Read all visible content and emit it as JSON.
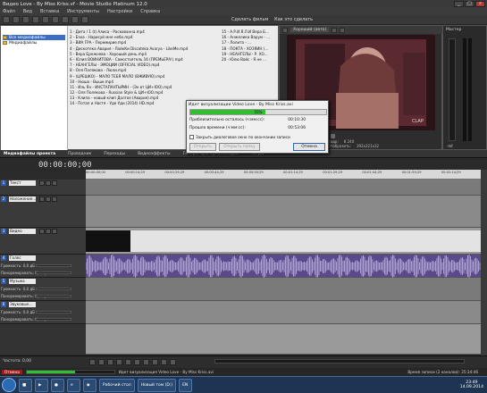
{
  "window": {
    "title": "Видео Love - By Miss Kriss.vf - Movie Studio Platinum 12.0",
    "controls": [
      "_",
      "□",
      "x"
    ]
  },
  "menu": [
    "Файл",
    "Вид",
    "Вставка",
    "Инструменты",
    "Настройки",
    "Справка"
  ],
  "toolbar": {
    "make_movie": "Сделать фильм",
    "as_this": "Как это сделать"
  },
  "media_tree": [
    "Все медиафайлы",
    "Медиафайлы"
  ],
  "media_files_col1": [
    "1 - Дита / 1 (t) Алиса - Раскованна.mp4",
    "2 - Бэха - Нарисуй мне небо.mp4",
    "3 - ВИА ГРА - Перемирие.mp4",
    "4 - Дискотека Авария - ЛайкКи Disсoteka Avarya - LikeMe.mp4",
    "5 - Вера Брежнева - Хороший день.mp4",
    "6 - Юлия ВОИНИТОВА - Самостоятель 16 (ПРЕМЬЕРА!).mp4",
    "7 - НЕАНГЕЛЫ - ЭМОЦИИ (OFFICIAL VIDEO).mp4",
    "8 - Оля Полякова - Люли.mp4",
    "9 - (ЦРЕШКО) - МАЛО ТЕБЯ МАЛО (ВЖИВУЮ).mp4",
    "10 - Нюша - Выше.mp4",
    "11 - Иль Ян - ИНСТАПАНТЫРИН - (Эн вт ЦИ+ЮО).mp4",
    "12 - Оля Полякова - Russian Style & ЦИ+ЮО.mp4",
    "13 - Клипа - новый клип Долгое (Авария).mp4",
    "14 - Потап и Настя - Уде Уди (2014) HD.mp4"
  ],
  "media_files_col2": [
    "15 - А.Р.И.Я.Л.И Вера Б...",
    "16 - Анжелика Варум - ...",
    "17 - Лолита - ...",
    "18 - ПОКТА - ХОЗЯИН (...",
    "19 - НЕАНГЕЛЫ - Р. ХО...",
    "20 - Юлю Войс - Я не ..."
  ],
  "preview": {
    "quality": "Хороший (авто)",
    "watermark": "CLAP",
    "info_project": "1280x720, 25.000i",
    "info_preview": "1280x720, 25.000i",
    "info_display": "1280x720, 25.000i",
    "frame_label": "Кадр:",
    "frame_value": "8 240",
    "display_label": "Отобразить:",
    "display_value": "392x221x32"
  },
  "master": {
    "label": "Мастер",
    "fader": "-Inf."
  },
  "tabs": [
    "Медиафайлы проекта",
    "Проводник",
    "Переходы",
    "Видеоэффекты",
    "Генераторы мультимедиа",
    "Титры"
  ],
  "timecode": "00:00:00;00",
  "ruler_ticks": [
    "00:00:00;00",
    "00:00:14;29",
    "00:00:29;29",
    "00:00:44;29",
    "00:00:59;29",
    "00:01:14;29",
    "00:01:29;29",
    "00:01:44;29",
    "00:01:59;29",
    "00:02:14;29"
  ],
  "tracks": [
    {
      "num": "1",
      "name": "Текст"
    },
    {
      "num": "2",
      "name": "Наложение..."
    },
    {
      "num": "3",
      "name": "Видео"
    },
    {
      "num": "4",
      "name": "Голос",
      "params": [
        "Громкость: 0,0 дБ",
        "Панорамировать: Центр"
      ]
    },
    {
      "num": "5",
      "name": "Музыка",
      "params": [
        "Громкость: 0,0 дБ",
        "Панорамировать: Центр"
      ]
    },
    {
      "num": "6",
      "name": "Звуковые...",
      "params": [
        "Громкость: 0,0 дБ",
        "Панорамировать: Центр"
      ]
    }
  ],
  "status": {
    "rate": "Частота: 0,00",
    "progress_label": "Отмена",
    "progress_text": "Идет визуализация Video Love - By Miss Kriss.avi",
    "record_time": "Время записи (2 каналов): 25:34:46"
  },
  "dialog": {
    "title": "Идет визуализации Video Love - By Miss Kriss.avi",
    "progress_pct": 55,
    "progress_text": "55%",
    "remaining_label": "Приблизительно осталось (ч:мм:сс):",
    "remaining_value": "00:10:30",
    "elapsed_label": "Прошло времени (ч:мм:сс):",
    "elapsed_value": "00:53:06",
    "close_on_finish": "Закрыть диалоговое окно по окончании записи",
    "btn_open": "Открыть",
    "btn_open_folder": "Открыть папку",
    "btn_cancel": "Отмена"
  },
  "taskbar": {
    "tasks": [
      "Рабочий стол",
      "Новый том (D:)",
      "EN"
    ],
    "time": "23:49",
    "date": "14.09.2014"
  }
}
